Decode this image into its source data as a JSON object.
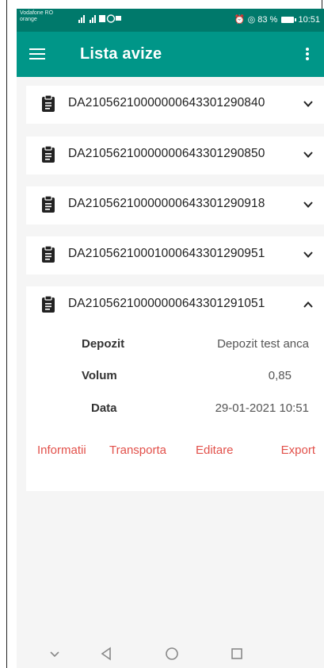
{
  "status_bar": {
    "carrier_line1": "Vodafone RO",
    "carrier_line2": "orange",
    "battery": "83 %",
    "time": "10:51"
  },
  "app_bar": {
    "title": "Lista avize",
    "menu_icon": "hamburger-icon",
    "more_icon": "more-vert-icon"
  },
  "accent_color": "#009688",
  "action_color": "#e2504a",
  "avize": [
    {
      "id": "DA21056210000000643301290840",
      "expanded": false
    },
    {
      "id": "DA21056210000000643301290850",
      "expanded": false
    },
    {
      "id": "DA21056210000000643301290918",
      "expanded": false
    },
    {
      "id": "DA21056210001000643301290951",
      "expanded": false
    },
    {
      "id": "DA21056210000000643301291051",
      "expanded": true
    }
  ],
  "details": {
    "depozit_label": "Depozit",
    "depozit_value": "Depozit test anca",
    "volum_label": "Volum",
    "volum_value": "0,85",
    "data_label": "Data",
    "data_value": "29-01-2021 10:51"
  },
  "actions": {
    "informatii": "Informatii",
    "transporta": "Transporta",
    "editare": "Editare",
    "export": "Export"
  }
}
